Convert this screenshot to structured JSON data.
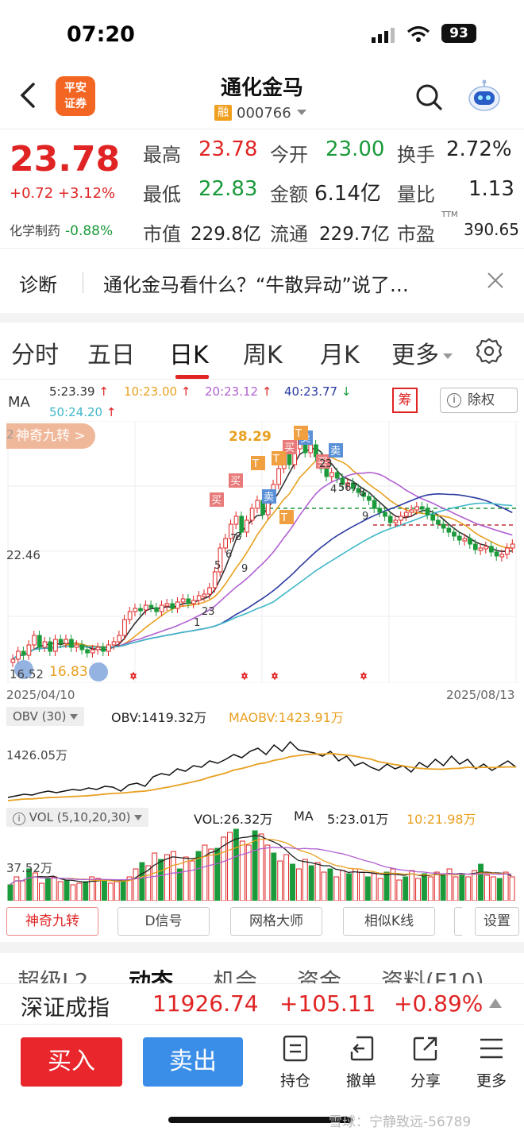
{
  "status_bar": {
    "time": "07:20",
    "battery": "93"
  },
  "header": {
    "broker_logo": [
      "平安",
      "证券"
    ],
    "stock_name": "通化金马",
    "margin_badge": "融",
    "stock_code": "000766"
  },
  "quote": {
    "last_price": "23.78",
    "change": "+0.72 +3.12%",
    "sector_name": "化学制药",
    "sector_change": "-0.88%",
    "fields": [
      {
        "label": "最高",
        "value": "23.78",
        "color": "#e02424"
      },
      {
        "label": "今开",
        "value": "23.00",
        "color": "#1a9a3a"
      },
      {
        "label": "换手",
        "value": "2.72%",
        "color": "#222222"
      },
      {
        "label": "最低",
        "value": "22.83",
        "color": "#1a9a3a"
      },
      {
        "label": "金额",
        "value": "6.14亿",
        "color": "#222222"
      },
      {
        "label": "量比",
        "value": "1.13",
        "color": "#222222"
      },
      {
        "label": "市值",
        "value": "229.8亿",
        "color": "#222222"
      },
      {
        "label": "流通",
        "value": "229.7亿",
        "color": "#222222"
      },
      {
        "label": "市盈",
        "value": "390.65",
        "color": "#222222"
      }
    ],
    "pe_superscript": "TTM"
  },
  "diagnosis": {
    "label": "诊断",
    "text": "通化金马看什么？“牛散异动”说了…"
  },
  "period_tabs": [
    "分时",
    "五日",
    "日K",
    "周K",
    "月K",
    "更多"
  ],
  "active_period": "日K",
  "ma_legend": {
    "title": "MA",
    "items": [
      {
        "text": "5:23.39",
        "arrow": "↑",
        "color": "#333333"
      },
      {
        "text": "10:23.00",
        "arrow": "↑",
        "color": "#e8a020"
      },
      {
        "text": "20:23.12",
        "arrow": "↑",
        "color": "#b060d0"
      },
      {
        "text": "40:23.77",
        "arrow": "↓",
        "color": "#2a3aa0"
      },
      {
        "text": "50:24.20",
        "arrow": "↑",
        "color": "#40b8c8"
      }
    ],
    "chip_button": "筹",
    "adjust_button": "除权"
  },
  "kline": {
    "magic_tag": "神奇九转 >",
    "price_high": "28.29",
    "price_mid": "22.46",
    "price_low_partial": "2",
    "low_mark": "16.83",
    "low_axis": "16.52",
    "date_start": "2025/04/10",
    "date_end": "2025/08/13",
    "signals": [
      "买",
      "卖",
      "T"
    ]
  },
  "obv_panel": {
    "tag": "OBV (30)",
    "obv": "OBV:1419.32万",
    "maobv": "MAOBV:1423.91万",
    "axis_label": "1426.05万"
  },
  "vol_panel": {
    "tag": "VOL (5,10,20,30)",
    "vol": "VOL:26.32万",
    "ma_label": "MA",
    "ma5": "5:23.01万",
    "ma10": "10:21.98万",
    "axis_label": "37.52万"
  },
  "indicator_buttons": [
    "神奇九转",
    "D信号",
    "网格大师",
    "相似K线",
    "设置"
  ],
  "info_tabs": [
    "超级L2",
    "动态",
    "机会",
    "资金",
    "资料(F10)"
  ],
  "index_bar": {
    "name": "深证成指",
    "value": "11926.74",
    "change": "+105.11",
    "pct": "+0.89%"
  },
  "trade_bar": {
    "buy": "买入",
    "sell": "卖出",
    "items": [
      "持仓",
      "撤单",
      "分享",
      "更多"
    ]
  },
  "watermark": "雪球：宁静致远-56789",
  "colors": {
    "up": "#e02424",
    "down": "#1a9a3a",
    "buy": "#e8262b",
    "sell": "#3a8ee8",
    "brand": "#f26522"
  }
}
